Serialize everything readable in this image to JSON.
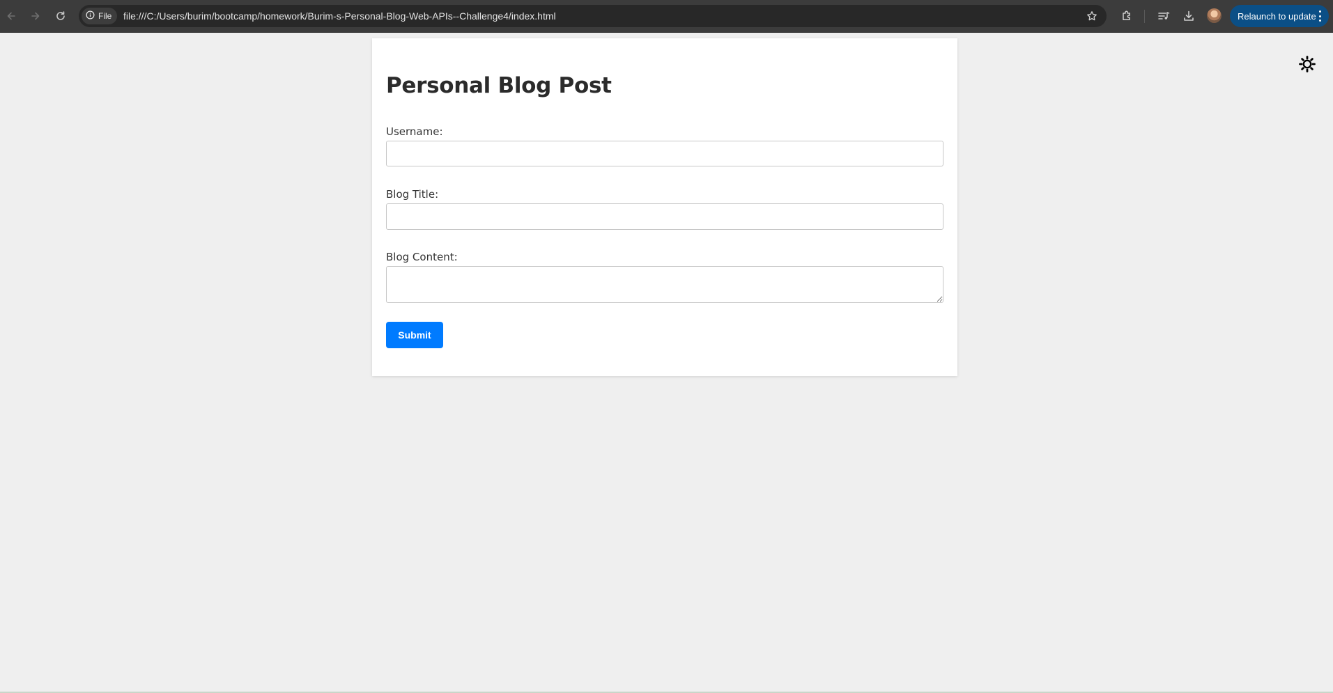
{
  "browser": {
    "site_chip_label": "File",
    "url": "file:///C:/Users/burim/bootcamp/homework/Burim-s-Personal-Blog-Web-APIs--Challenge4/index.html",
    "relaunch_label": "Relaunch to update",
    "icons": [
      "back-arrow-icon",
      "forward-arrow-icon",
      "reload-icon",
      "info-icon",
      "star-icon",
      "extensions-icon",
      "media-controls-icon",
      "download-icon",
      "profile-avatar",
      "more-vert-icon"
    ]
  },
  "page": {
    "theme_toggle_icon": "sun-icon",
    "form": {
      "title": "Personal Blog Post",
      "username_label": "Username:",
      "username_value": "",
      "blog_title_label": "Blog Title:",
      "blog_title_value": "",
      "blog_content_label": "Blog Content:",
      "blog_content_value": "",
      "submit_label": "Submit"
    }
  },
  "colors": {
    "page_background": "#efefef",
    "card_background": "#ffffff",
    "submit_button": "#007bff",
    "toolbar": "#3c3c3c",
    "relaunch_button": "#0b4f86"
  }
}
